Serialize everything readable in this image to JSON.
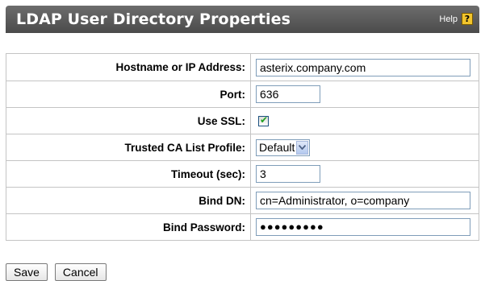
{
  "header": {
    "title": "LDAP User Directory Properties",
    "help_label": "Help",
    "help_icon": "question-mark-icon",
    "help_icon_glyph": "?"
  },
  "form": {
    "hostname": {
      "label": "Hostname or IP Address:",
      "value": "asterix.company.com"
    },
    "port": {
      "label": "Port:",
      "value": "636"
    },
    "use_ssl": {
      "label": "Use SSL:",
      "checked": true,
      "check_glyph": "✔"
    },
    "trusted_ca": {
      "label": "Trusted CA List Profile:",
      "selected": "Default"
    },
    "timeout": {
      "label": "Timeout (sec):",
      "value": "3"
    },
    "bind_dn": {
      "label": "Bind DN:",
      "value": "cn=Administrator, o=company"
    },
    "bind_password": {
      "label": "Bind Password:",
      "masked_value": "●●●●●●●●●"
    }
  },
  "actions": {
    "save_label": "Save",
    "cancel_label": "Cancel"
  },
  "colors": {
    "titlebar": "#5c5c5c",
    "help_icon": "#f2c52c",
    "checkmark": "#21a121",
    "border": "#c4c4c4"
  }
}
